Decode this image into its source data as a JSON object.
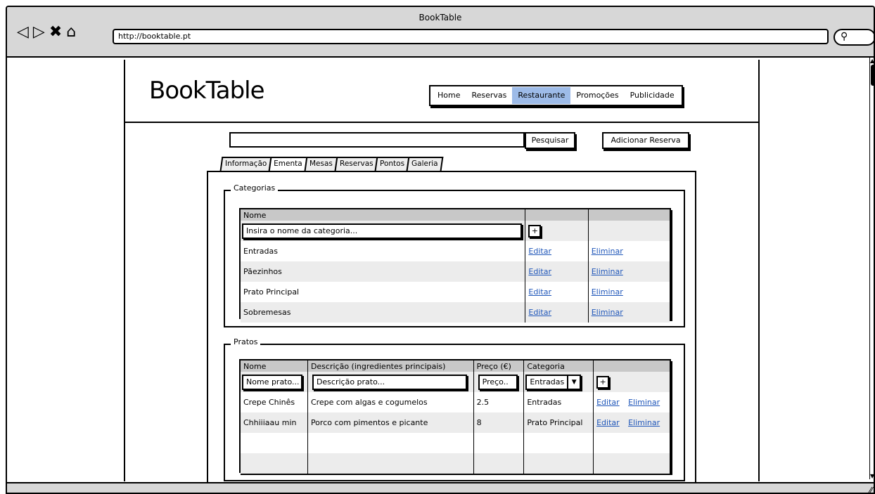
{
  "window": {
    "title": "BookTable",
    "url": "http://booktable.pt"
  },
  "nav_icons": {
    "back": "◁",
    "forward": "▷",
    "stop": "✖",
    "home": "⌂",
    "search": "🔍︎"
  },
  "site": {
    "logo": "BookTable",
    "menu": [
      {
        "label": "Home",
        "active": false
      },
      {
        "label": "Reservas",
        "active": false
      },
      {
        "label": "Restaurante",
        "active": true
      },
      {
        "label": "Promoções",
        "active": false
      },
      {
        "label": "Publicidade",
        "active": false
      }
    ]
  },
  "search": {
    "button": "Pesquisar",
    "add_button": "Adicionar Reserva",
    "value": ""
  },
  "tabs": [
    {
      "label": "Informação",
      "active": false
    },
    {
      "label": "Ementa",
      "active": true
    },
    {
      "label": "Mesas",
      "active": false
    },
    {
      "label": "Reservas",
      "active": false
    },
    {
      "label": "Pontos",
      "active": false
    },
    {
      "label": "Galeria",
      "active": false
    }
  ],
  "categorias": {
    "legend": "Categorias",
    "header": {
      "nome": "Nome"
    },
    "new_placeholder": "Insira o nome da categoria...",
    "add_label": "+",
    "rows": [
      {
        "nome": "Entradas",
        "edit": "Editar",
        "delete": "Eliminar"
      },
      {
        "nome": "Pãezinhos",
        "edit": "Editar",
        "delete": "Eliminar"
      },
      {
        "nome": "Prato Principal",
        "edit": "Editar",
        "delete": "Eliminar"
      },
      {
        "nome": "Sobremesas",
        "edit": "Editar",
        "delete": "Eliminar"
      }
    ]
  },
  "pratos": {
    "legend": "Pratos",
    "headers": {
      "nome": "Nome",
      "descricao": "Descrição (ingredientes principais)",
      "preco": "Preço (€)",
      "categoria": "Categoria"
    },
    "inputs": {
      "nome": "Nome prato...",
      "descricao": "Descrição prato...",
      "preco": "Preço..",
      "categoria": "Entradas",
      "add": "+"
    },
    "rows": [
      {
        "nome": "Crepe Chinês",
        "descricao": "Crepe com algas e cogumelos",
        "preco": "2.5",
        "categoria": "Entradas",
        "edit": "Editar",
        "delete": "Eliminar"
      },
      {
        "nome": "Chhiiiaau min",
        "descricao": "Porco com pimentos e picante",
        "preco": "8",
        "categoria": "Prato Principal",
        "edit": "Editar",
        "delete": "Eliminar"
      }
    ]
  },
  "colors": {
    "active_menu": "#9dbbe8",
    "link": "#1f56b9",
    "chrome": "#d7d7d7"
  }
}
